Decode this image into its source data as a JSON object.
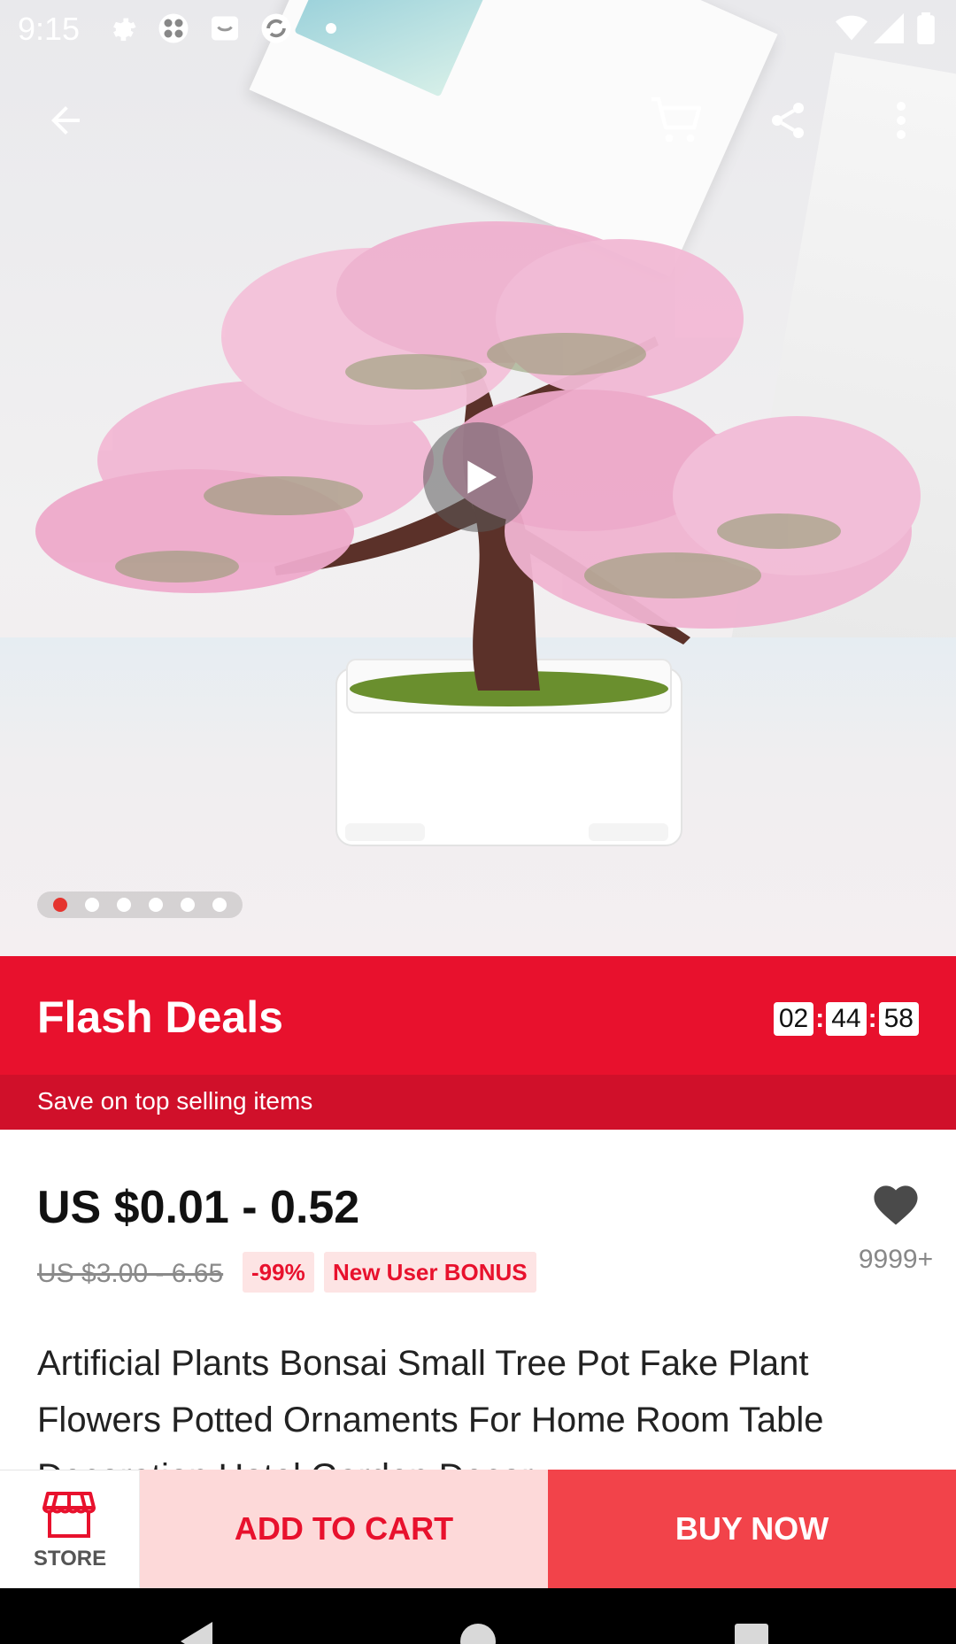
{
  "status_bar": {
    "time": "9:15"
  },
  "hero": {
    "image_alt": "Pink artificial bonsai tree in white pot",
    "slide_count": 6,
    "active_slide": 1
  },
  "flash_deals": {
    "title": "Flash Deals",
    "subtitle": "Save on top selling items",
    "timer": {
      "hours": "02",
      "minutes": "44",
      "seconds": "58"
    }
  },
  "product": {
    "price": "US $0.01 - 0.52",
    "original_price": "US $3.00 - 6.65",
    "discount_badge": "-99%",
    "bonus_badge": "New User BONUS",
    "wishlist_count": "9999+",
    "title": "Artificial Plants Bonsai Small Tree Pot Fake Plant Flowers Potted Ornaments For Home Room Table Decoration Hotel Garden Decor"
  },
  "action_bar": {
    "store_label": "STORE",
    "add_to_cart": "ADD TO CART",
    "buy_now": "BUY NOW"
  },
  "colors": {
    "accent_red": "#e8112d",
    "buy_now": "#f2434a",
    "add_cart_bg": "#fdd9d9"
  }
}
